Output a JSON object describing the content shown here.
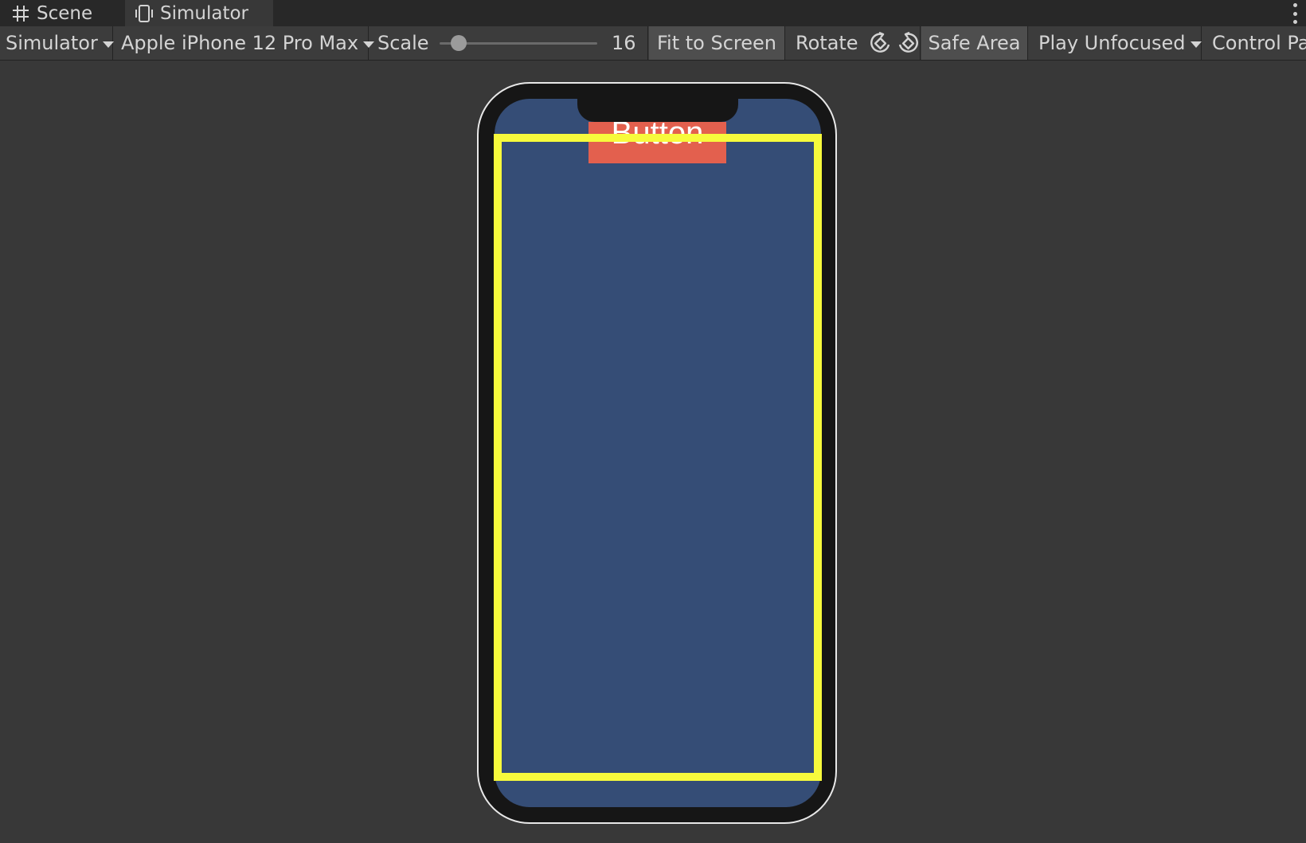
{
  "tabs": {
    "scene_label": "Scene",
    "simulator_label": "Simulator"
  },
  "toolbar": {
    "mode_label": "Simulator",
    "device_label": "Apple iPhone 12 Pro Max",
    "scale_label": "Scale",
    "scale_value": "16",
    "scale_fraction": 0.08,
    "fit_label": "Fit to Screen",
    "rotate_label": "Rotate",
    "safe_area_label": "Safe Area",
    "play_label": "Play Unfocused",
    "control_label": "Control Pa"
  },
  "simulator": {
    "button_text": "Button",
    "colors": {
      "screen": "#354d76",
      "button": "#e3604e",
      "safe_area_outline": "#f7fa3c",
      "device_frame": "#161616"
    }
  },
  "icons": [
    "grid-icon",
    "device-icon",
    "rotate-cw-icon",
    "rotate-ccw-icon",
    "more-vertical-icon"
  ]
}
